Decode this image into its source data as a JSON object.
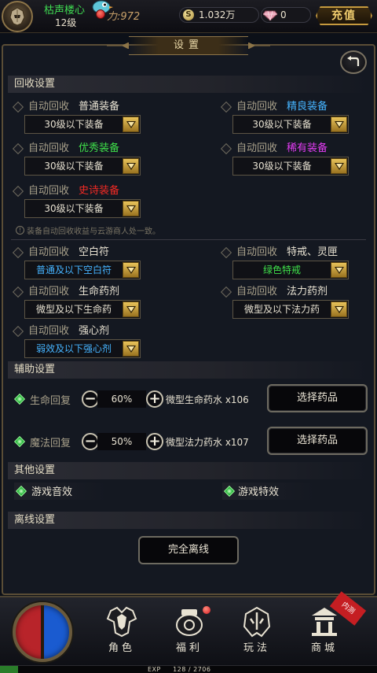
{
  "player": {
    "name": "枯声楼心",
    "level": "12级",
    "power": "力:972"
  },
  "currency": {
    "gold_icon": "S",
    "gold": "1.032万",
    "gems": "0"
  },
  "header": {
    "recharge_label": "充值"
  },
  "panel": {
    "title": "设置"
  },
  "recycle": {
    "section_title": "回收设置",
    "prefix": "自动回收",
    "items": [
      {
        "quality": "普通装备",
        "quality_color": "#e8e2d2",
        "value": "30级以下装备",
        "value_color": "#e8e2d2",
        "enabled": false
      },
      {
        "quality": "精良装备",
        "quality_color": "#46b4ff",
        "value": "30级以下装备",
        "value_color": "#e8e2d2",
        "enabled": false
      },
      {
        "quality": "优秀装备",
        "quality_color": "#3fe04a",
        "value": "30级以下装备",
        "value_color": "#e8e2d2",
        "enabled": false
      },
      {
        "quality": "稀有装备",
        "quality_color": "#e23cf2",
        "value": "30级以下装备",
        "value_color": "#e8e2d2",
        "enabled": false
      },
      {
        "quality": "史诗装备",
        "quality_color": "#f22a24",
        "value": "30级以下装备",
        "value_color": "#e8e2d2",
        "enabled": false
      }
    ],
    "note": "装备自动回收收益与云游商人处一致。",
    "misc": [
      {
        "quality": "空白符",
        "quality_color": "#e8e2d2",
        "value": "普通及以下空白符",
        "value_color": "#46b4ff",
        "enabled": false
      },
      {
        "quality": "特戒、灵匣",
        "quality_color": "#e8e2d2",
        "value": "绿色特戒",
        "value_color": "#3fe04a",
        "enabled": false
      },
      {
        "quality": "生命药剂",
        "quality_color": "#e8e2d2",
        "value": "微型及以下生命药",
        "value_color": "#e8e2d2",
        "enabled": false
      },
      {
        "quality": "法力药剂",
        "quality_color": "#e8e2d2",
        "value": "微型及以下法力药",
        "value_color": "#e8e2d2",
        "enabled": false
      },
      {
        "quality": "强心剂",
        "quality_color": "#e8e2d2",
        "value": "弱效及以下强心剂",
        "value_color": "#46b4ff",
        "enabled": false
      }
    ]
  },
  "assist": {
    "section_title": "辅助设置",
    "hp": {
      "label": "生命回复",
      "percent": "60%",
      "potion": "微型生命药水 x106",
      "button": "选择药品",
      "enabled": true
    },
    "mp": {
      "label": "魔法回复",
      "percent": "50%",
      "potion": "微型法力药水 x107",
      "button": "选择药品",
      "enabled": true
    },
    "minus": "−",
    "plus": "+"
  },
  "other": {
    "section_title": "其他设置",
    "sound": {
      "label": "游戏音效",
      "enabled": true
    },
    "effects": {
      "label": "游戏特效",
      "enabled": true
    }
  },
  "offline": {
    "section_title": "离线设置",
    "button": "完全离线"
  },
  "nav": {
    "items": [
      "角色",
      "福利",
      "玩法",
      "商城"
    ],
    "ribbon": "内测"
  },
  "exp": {
    "label": "EXP",
    "value": "128 / 2706",
    "fraction": 0.047
  },
  "colors": {
    "accent_gold": "#c69a3e",
    "panel_bg": "#141821",
    "green_on": "#24b83a"
  }
}
